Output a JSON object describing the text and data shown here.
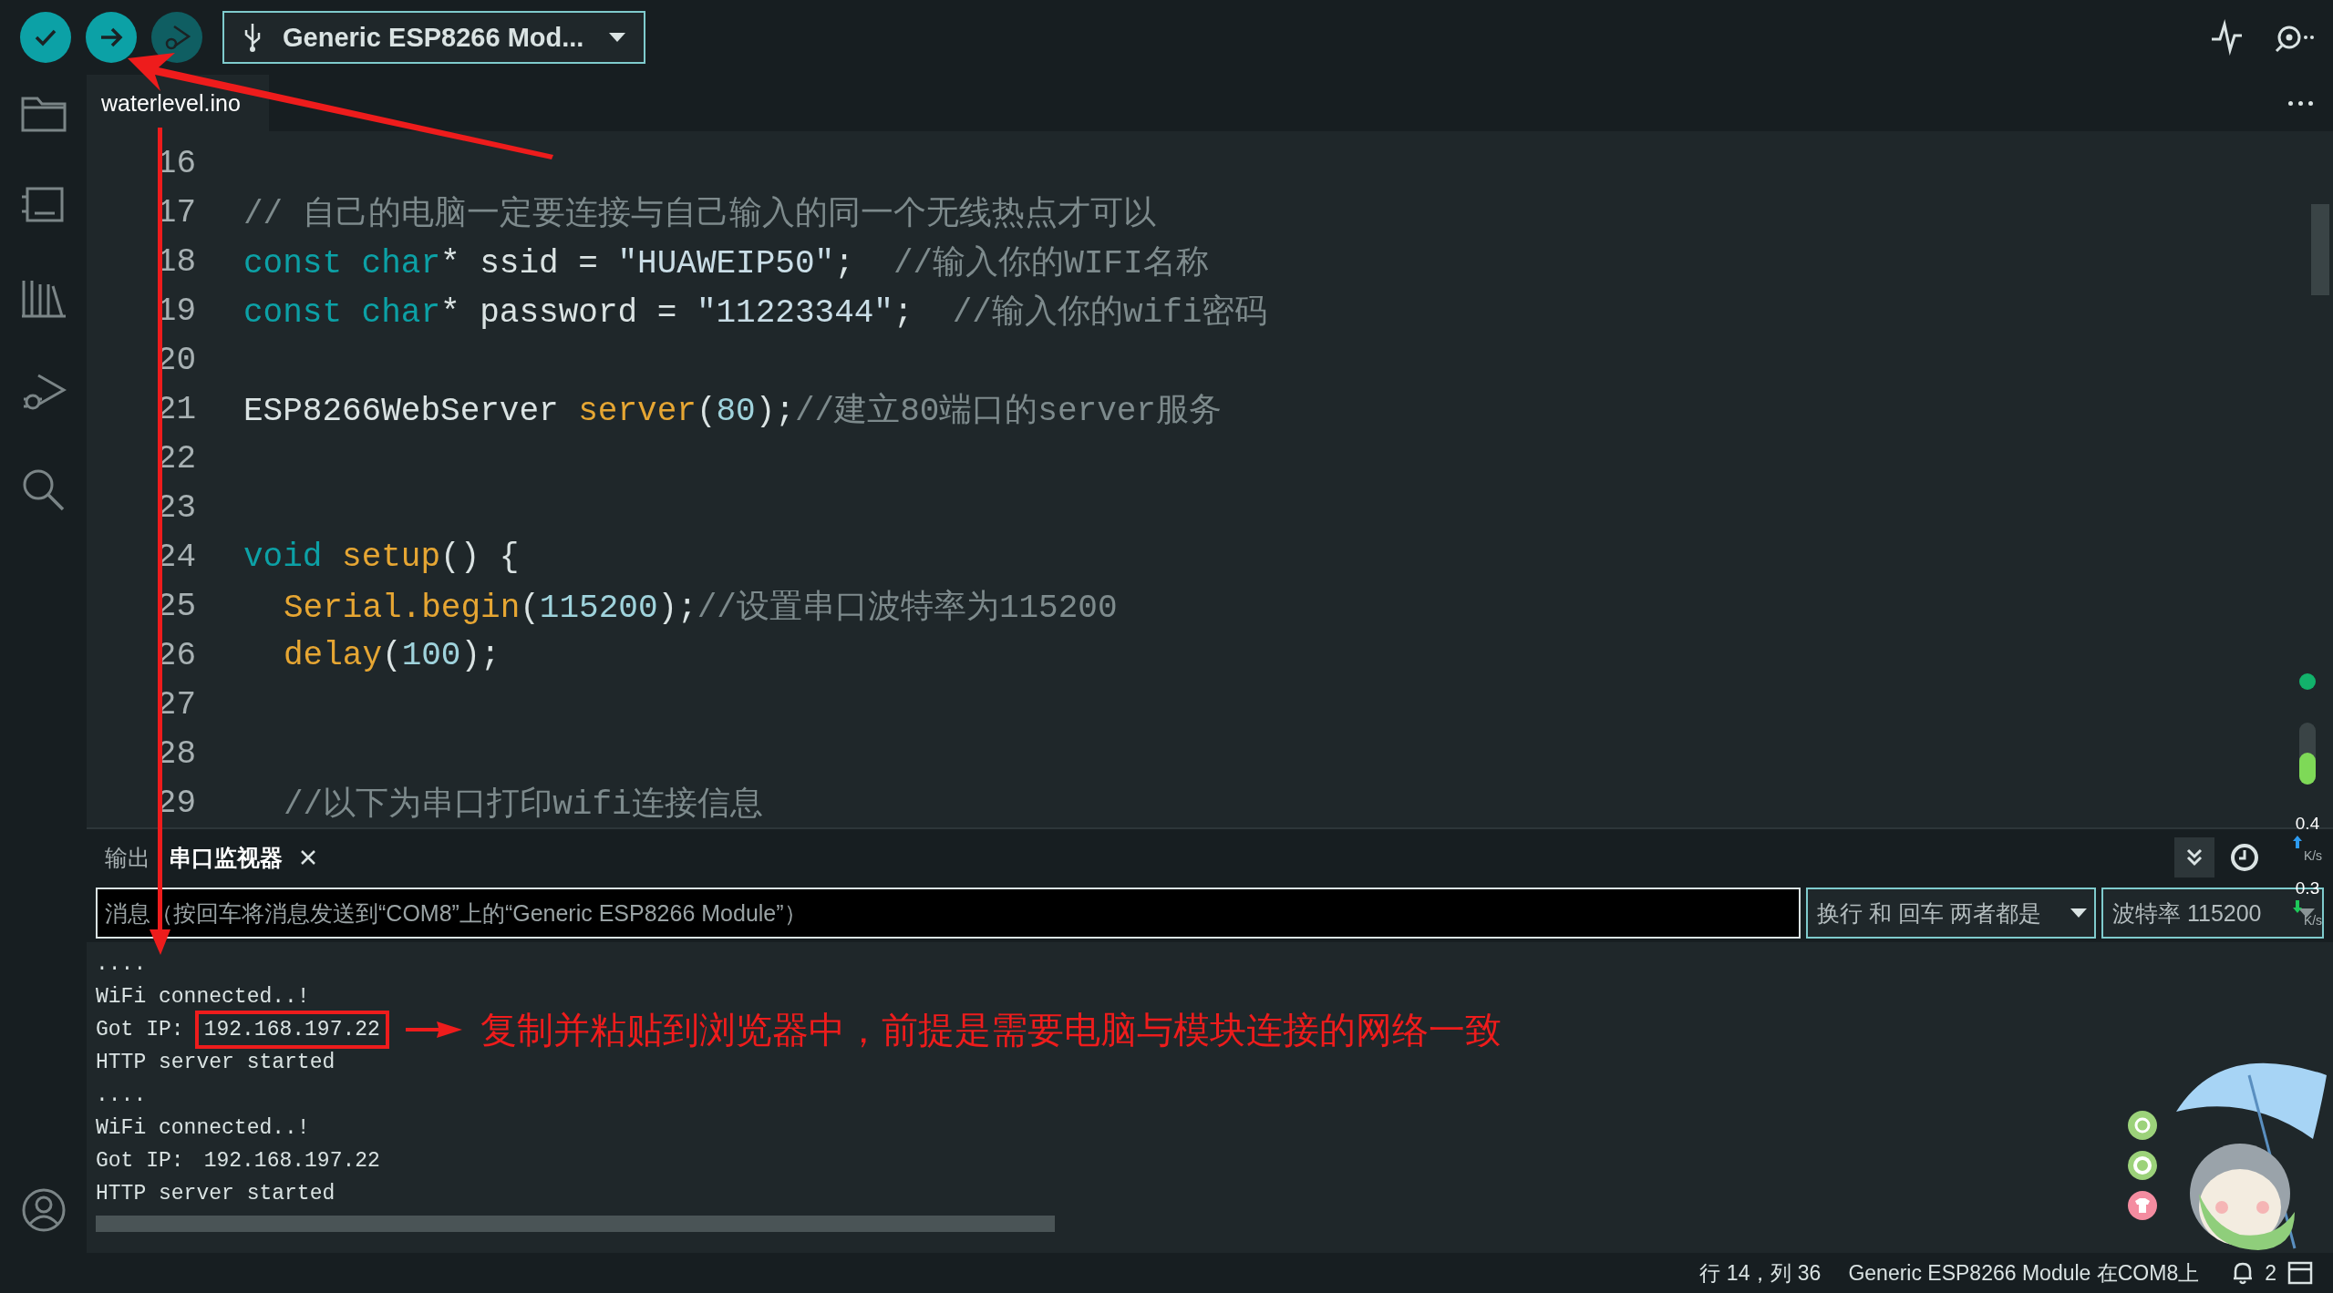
{
  "toolbar": {
    "buttons": [
      {
        "kind": "verify",
        "disabled": false
      },
      {
        "kind": "upload",
        "disabled": false
      },
      {
        "kind": "debug",
        "disabled": true
      }
    ],
    "board_selector": {
      "label": "Generic ESP8266 Mod..."
    }
  },
  "sidebar": {
    "items": [
      {
        "kind": "folder"
      },
      {
        "kind": "boards"
      },
      {
        "kind": "library"
      },
      {
        "kind": "debug"
      },
      {
        "kind": "search"
      }
    ]
  },
  "editor": {
    "tabs": [
      {
        "label": "waterlevel.ino",
        "selected": true
      }
    ],
    "lines": [
      {
        "number": "16"
      },
      {
        "number": "17",
        "indented": false,
        "tokens": [
          {
            "text": "// 自己的电脑一定要连接与自己输入的同一个无线热点才可以",
            "kind": "comment"
          }
        ]
      },
      {
        "number": "18",
        "indented": false,
        "tokens": [
          {
            "text": "const char",
            "kind": "keyword"
          },
          {
            "text": "* ssid = ",
            "kind": "plain"
          },
          {
            "text": "\"HUAWEIP50\"",
            "kind": "string"
          },
          {
            "text": ";  ",
            "kind": "plain"
          },
          {
            "text": "//输入你的WIFI名称",
            "kind": "comment"
          }
        ]
      },
      {
        "number": "19",
        "indented": false,
        "tokens": [
          {
            "text": "const char",
            "kind": "keyword"
          },
          {
            "text": "* password = ",
            "kind": "plain"
          },
          {
            "text": "\"11223344\"",
            "kind": "string"
          },
          {
            "text": ";  ",
            "kind": "plain"
          },
          {
            "text": "//输入你的wifi密码",
            "kind": "comment"
          }
        ]
      },
      {
        "number": "20"
      },
      {
        "number": "21",
        "indented": false,
        "tokens": [
          {
            "text": "ESP8266WebServer ",
            "kind": "plain"
          },
          {
            "text": "server",
            "kind": "function"
          },
          {
            "text": "(",
            "kind": "plain"
          },
          {
            "text": "80",
            "kind": "number"
          },
          {
            "text": ");",
            "kind": "plain"
          },
          {
            "text": "//建立80端口的server服务",
            "kind": "comment"
          }
        ]
      },
      {
        "number": "22"
      },
      {
        "number": "23"
      },
      {
        "number": "24",
        "indented": false,
        "tokens": [
          {
            "text": "void ",
            "kind": "keyword"
          },
          {
            "text": "setup",
            "kind": "function"
          },
          {
            "text": "() {",
            "kind": "plain"
          }
        ]
      },
      {
        "number": "25",
        "indented": true,
        "tokens": [
          {
            "text": "Serial.begin",
            "kind": "function"
          },
          {
            "text": "(",
            "kind": "plain"
          },
          {
            "text": "115200",
            "kind": "number"
          },
          {
            "text": ");",
            "kind": "plain"
          },
          {
            "text": "//设置串口波特率为115200",
            "kind": "comment"
          }
        ]
      },
      {
        "number": "26",
        "indented": true,
        "tokens": [
          {
            "text": "delay",
            "kind": "function"
          },
          {
            "text": "(",
            "kind": "plain"
          },
          {
            "text": "100",
            "kind": "number"
          },
          {
            "text": ");",
            "kind": "plain"
          }
        ]
      },
      {
        "number": "27"
      },
      {
        "number": "28"
      },
      {
        "number": "29",
        "indented": true,
        "tokens": [
          {
            "text": "//以下为串口打印wifi连接信息",
            "kind": "comment"
          }
        ]
      }
    ]
  },
  "panel": {
    "tabs": [
      {
        "label": "输出",
        "selected": false,
        "closable": false
      },
      {
        "label": "串口监视器",
        "selected": true,
        "closable": true
      }
    ],
    "message_field": {
      "placeholder": "消息（按回车将消息发送到“COM8”上的“Generic ESP8266 Module”）"
    },
    "line_ending": "换行 和 回车 两者都是",
    "baud_rate": "波特率 115200",
    "output": [
      {
        "text": "...."
      },
      {
        "text": "WiFi connected..!"
      },
      {
        "text": "Got IP:",
        "value": "192.168.197.22",
        "boxed": true
      },
      {
        "text": "HTTP server started"
      },
      {
        "text": "...."
      },
      {
        "text": "WiFi connected..!"
      },
      {
        "text": "Got IP:",
        "value": "192.168.197.22",
        "boxed": false
      },
      {
        "text": "HTTP server started"
      }
    ]
  },
  "annotation": {
    "note": "复制并粘贴到浏览器中，前提是需要电脑与模块连接的网络一致"
  },
  "network_widget": {
    "upload": "0.4",
    "upload_unit": "K/s",
    "download": "0.3",
    "download_unit": "K/s"
  },
  "status_bar": {
    "position": "行 14，列 36",
    "board": "Generic ESP8266 Module 在COM8上",
    "notifications": "2"
  }
}
